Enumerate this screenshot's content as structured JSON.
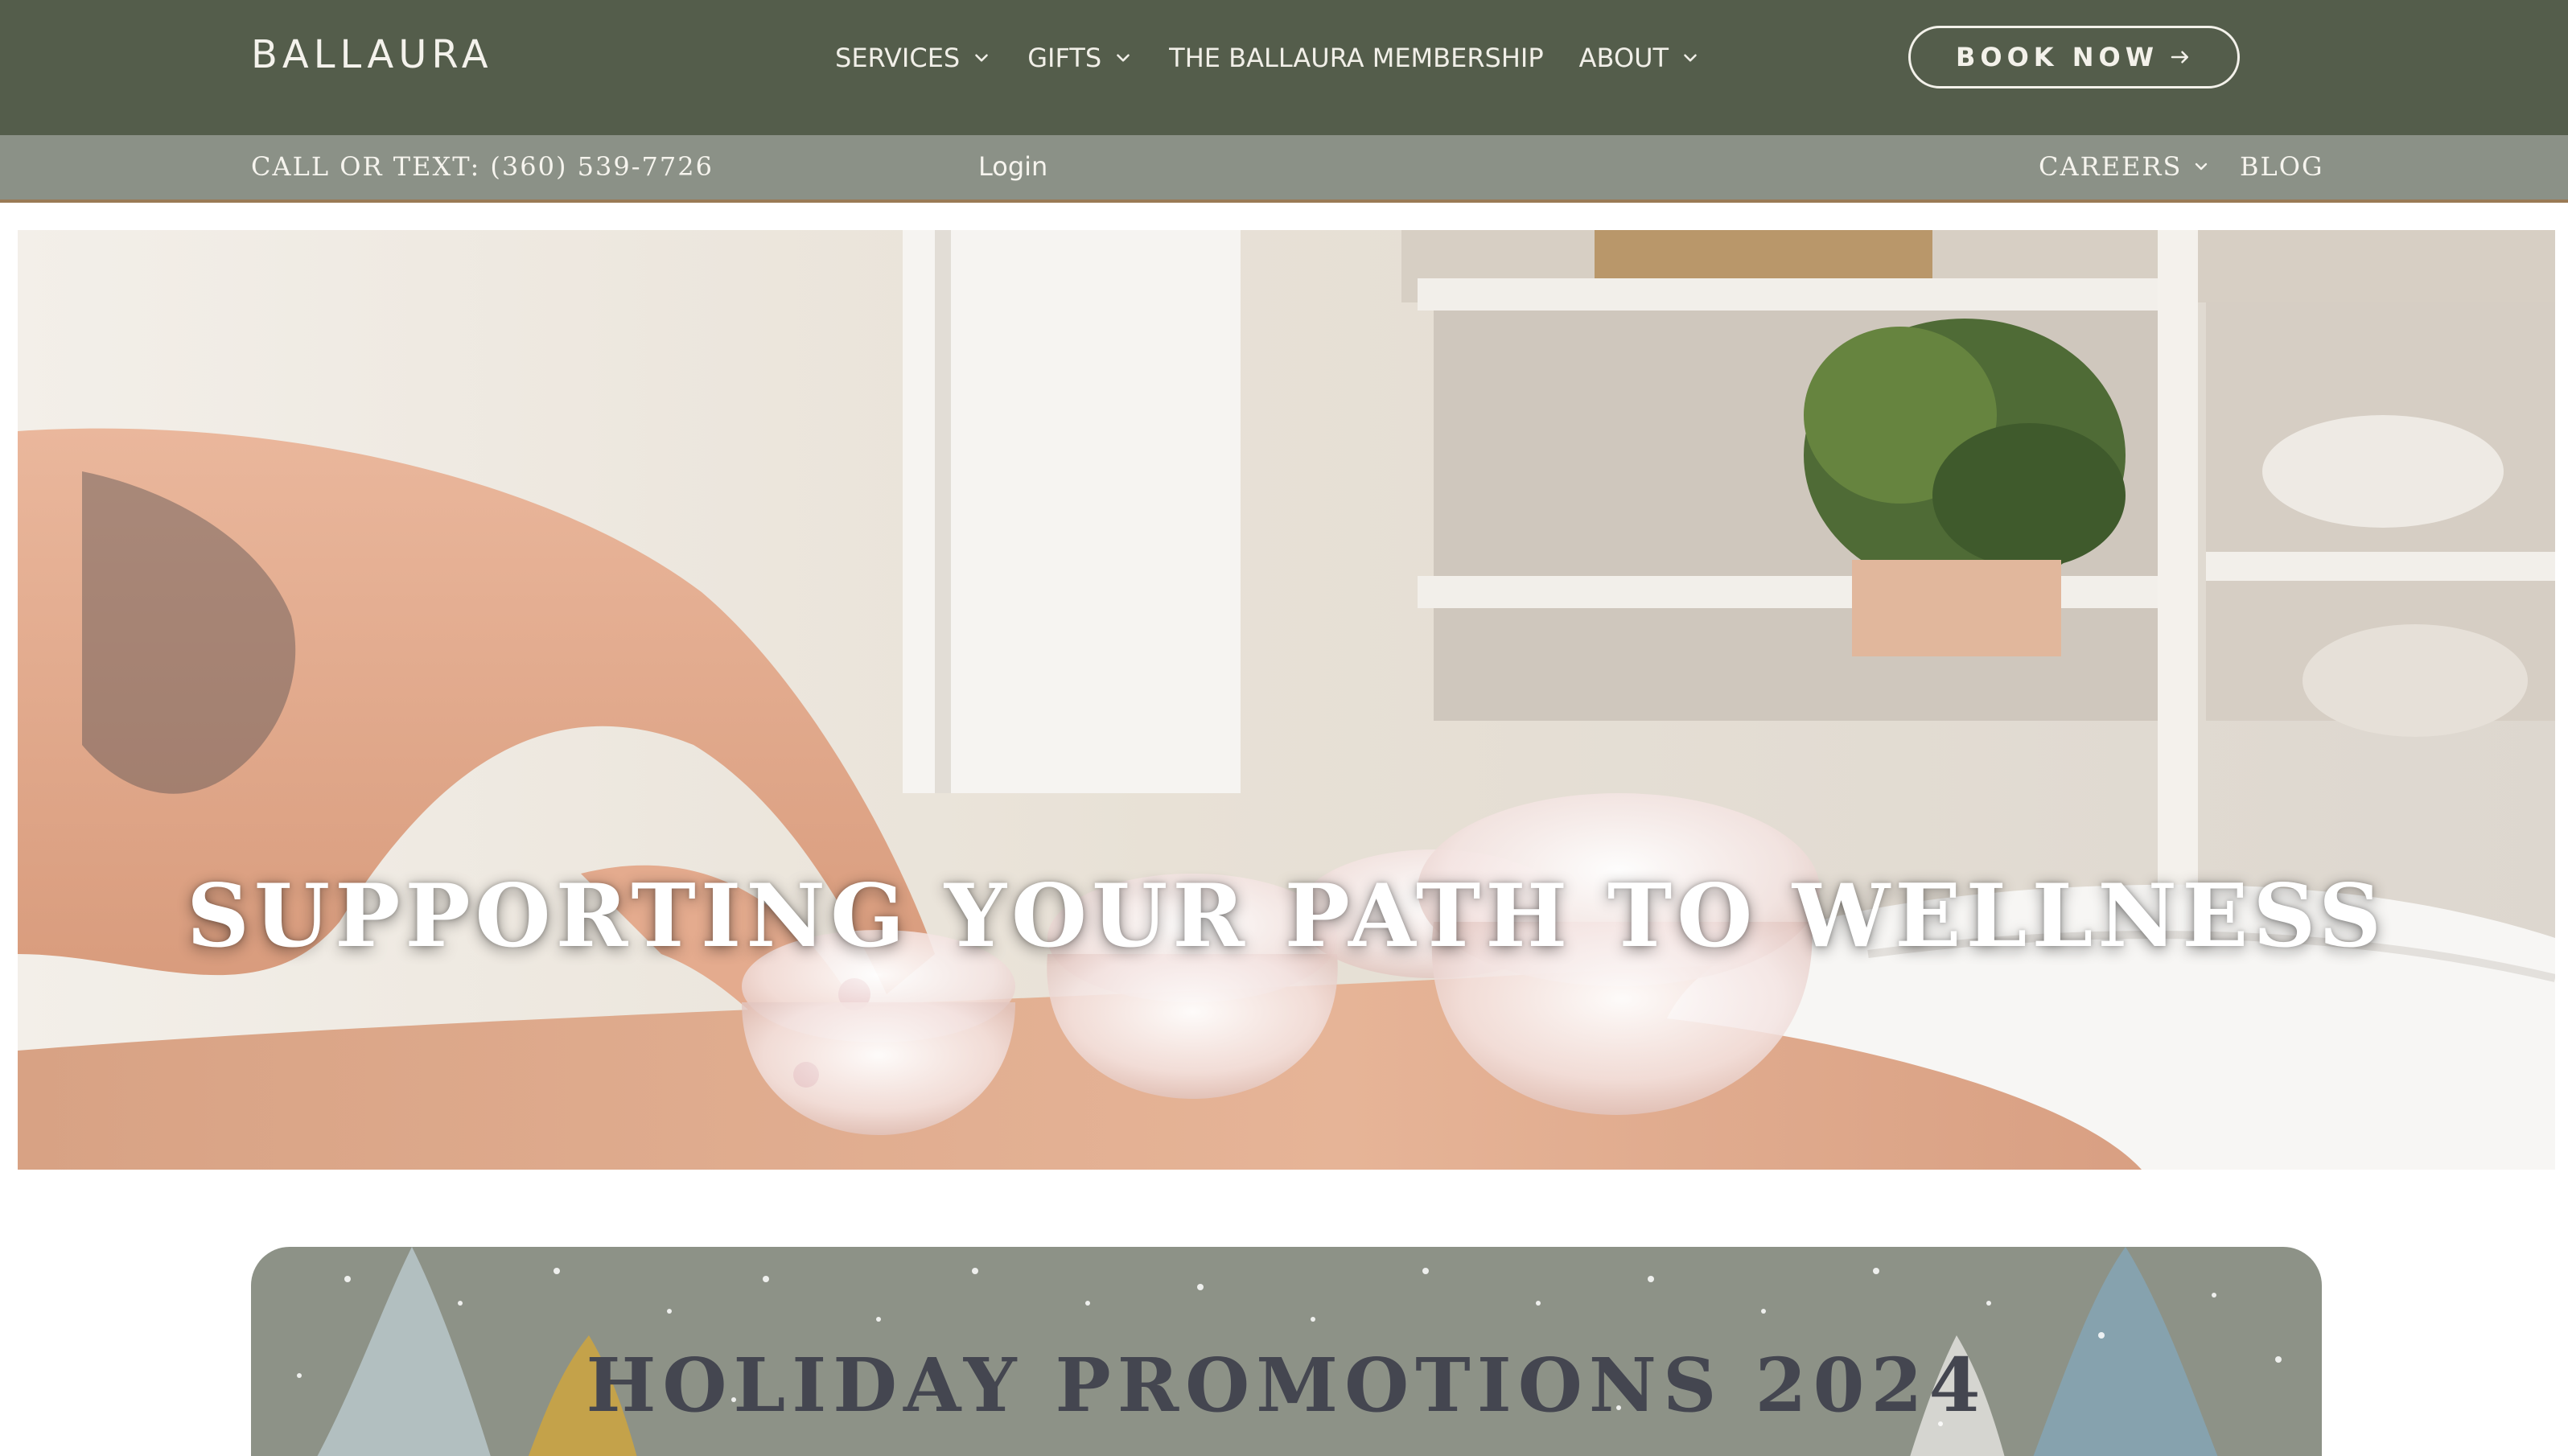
{
  "brand": {
    "name": "BALLAURA"
  },
  "nav": {
    "items": [
      {
        "label": "SERVICES",
        "has_dropdown": true
      },
      {
        "label": "GIFTS",
        "has_dropdown": true
      },
      {
        "label": "THE BALLAURA MEMBERSHIP",
        "has_dropdown": false
      },
      {
        "label": "ABOUT",
        "has_dropdown": true
      }
    ],
    "book_label": "BOOK NOW",
    "book_icon": "arrow-right-icon"
  },
  "subbar": {
    "phone": "CALL OR TEXT: (360) 539-7726",
    "login": "Login",
    "careers": "CAREERS",
    "blog": "BLOG"
  },
  "hero": {
    "title": "SUPPORTING YOUR PATH TO WELLNESS"
  },
  "promo": {
    "title": "HOLIDAY PROMOTIONS 2024"
  },
  "colors": {
    "nav_bg": "#545d4b",
    "subbar_bg": "#8b9187",
    "subbar_border": "#9a7a55",
    "promo_bg": "#8d9287",
    "promo_text": "#444650"
  }
}
